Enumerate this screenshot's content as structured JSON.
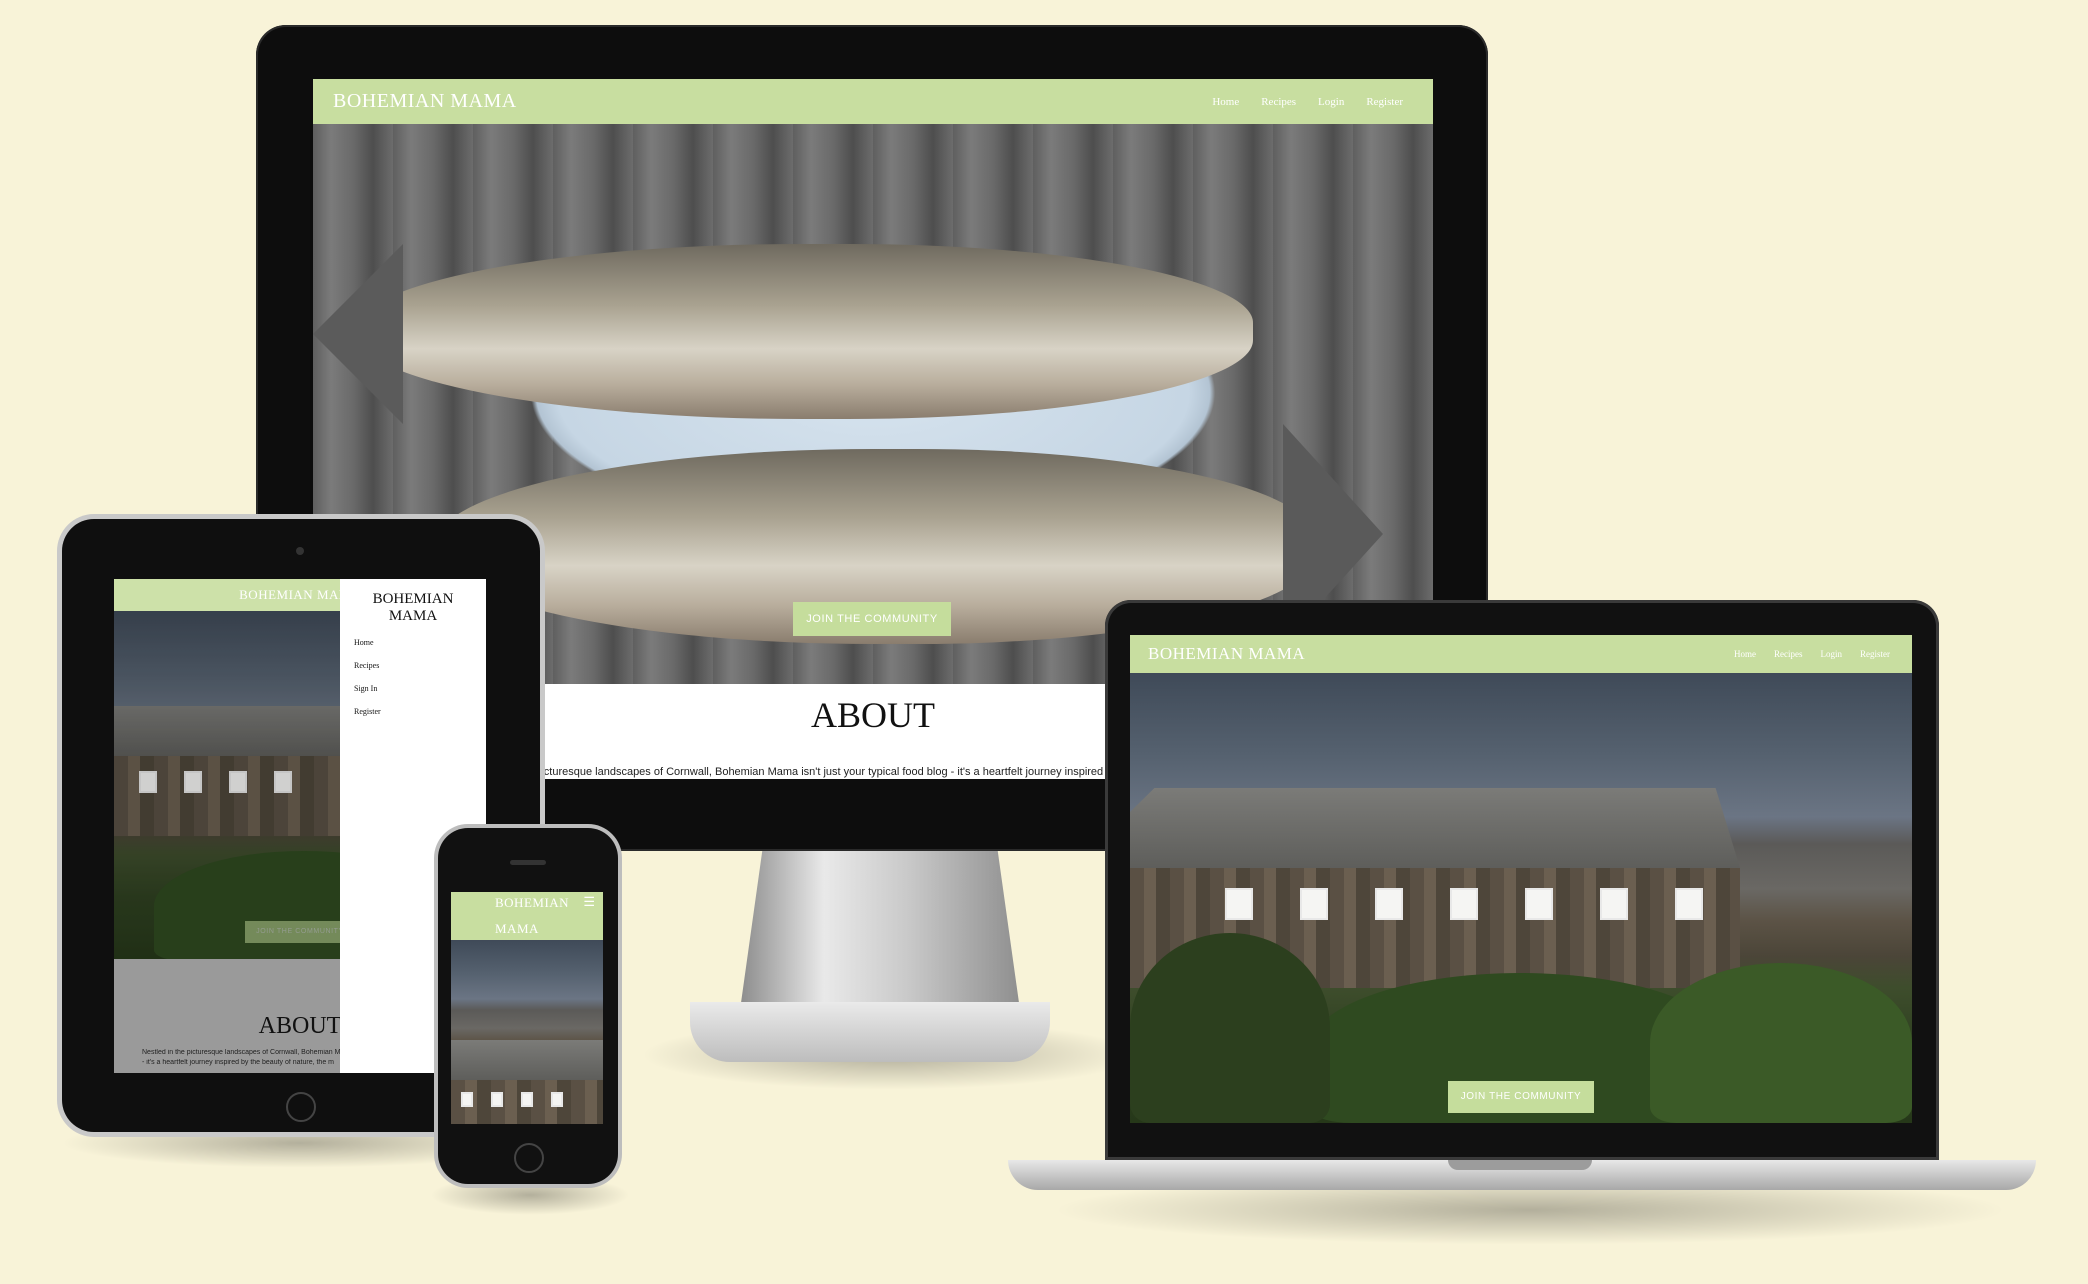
{
  "site": {
    "brand": "BOHEMIAN MAMA",
    "brand_mobile_line1": "BOHEMIAN",
    "brand_mobile_line2": "MAMA",
    "brand_drawer_line1": "BOHEMIAN",
    "brand_drawer_line2": "MAMA",
    "nav": [
      "Home",
      "Recipes",
      "Login",
      "Register"
    ],
    "drawer_nav": [
      "Home",
      "Recipes",
      "Sign In",
      "Register"
    ],
    "cta": "JOIN THE COMMUNITY",
    "about_title": "ABOUT",
    "about_text_desktop": "... picturesque landscapes of Cornwall, Bohemian Mama isn't just your typical food blog - it's a heartfelt journey inspired",
    "about_text_tablet_line1": "Nestled in the picturesque landscapes of Cornwall, Bohemian M",
    "about_text_tablet_line2": "- it's a heartfelt journey inspired by the beauty of nature, the m",
    "menu_icon": "hamburger-icon"
  },
  "colors": {
    "page_background": "#f8f3d8",
    "nav_green": "#c8dea0",
    "cta_green": "#c5dd9c",
    "device_black": "#0d0d0d"
  }
}
